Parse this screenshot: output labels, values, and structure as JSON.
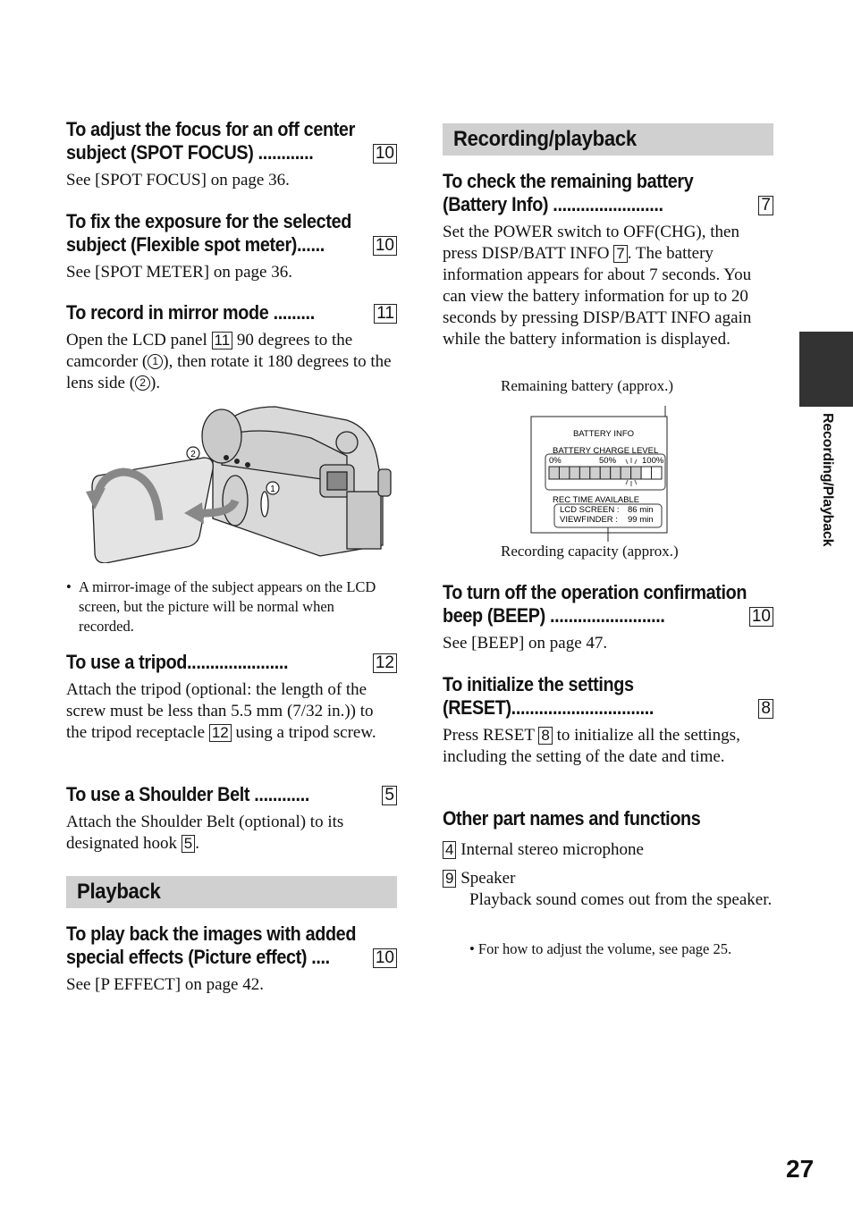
{
  "page_number": "27",
  "side_tab": {
    "label": "Recording/Playback",
    "color": "#333333"
  },
  "left": {
    "spot_focus": {
      "heading_line1": "To adjust the focus for an off center",
      "heading_line2": "subject (SPOT FOCUS) ............",
      "ref": "10",
      "body": "See [SPOT FOCUS] on page 36."
    },
    "spot_meter": {
      "heading_line1": "To fix the exposure for the selected",
      "heading_line2": "subject (Flexible spot meter)......",
      "ref": "10",
      "body": "See [SPOT METER] on page 36."
    },
    "mirror": {
      "heading": "To record in mirror mode .........",
      "ref": "11",
      "body_p1": "Open the LCD panel ",
      "body_ref": "11",
      "body_p2": " 90 degrees to the camcorder (",
      "step1": "1",
      "body_p3": "), then rotate it 180 degrees to the lens side (",
      "step2": "2",
      "body_p4": ").",
      "figure_alt": "Camcorder with LCD panel opened and rotated",
      "note": "A mirror-image of the subject appears on the LCD screen, but the picture will be normal when recorded."
    },
    "tripod": {
      "heading": "To use a tripod......................",
      "ref": "12",
      "body_p1": "Attach the tripod (optional: the length of the screw must be less than 5.5 mm (7/32 in.)) to the tripod receptacle ",
      "body_ref": "12",
      "body_p2": " using a tripod screw."
    },
    "belt": {
      "heading": "To use a Shoulder Belt ............",
      "ref": "5",
      "body_p1": "Attach the Shoulder Belt (optional) to its designated hook ",
      "body_ref": "5",
      "body_p2": "."
    },
    "playback_section": "Playback",
    "picture_effect": {
      "heading_line1": "To play back the images with added",
      "heading_line2": "special effects (Picture effect) ....",
      "ref": "10",
      "body": "See [P EFFECT] on page 42."
    }
  },
  "right": {
    "section": "Recording/playback",
    "battery": {
      "heading_line1": "To check the remaining battery",
      "heading_line2": "(Battery Info) ........................",
      "ref": "7",
      "body_p1": "Set the POWER switch to OFF(CHG), then press DISP/BATT INFO ",
      "body_ref": "7",
      "body_p2": ". The battery information appears for about 7 seconds. You can view the battery information for up to 20 seconds by pressing DISP/BATT INFO again while the battery information is displayed.",
      "callout_top": "Remaining battery (approx.)",
      "callout_bottom": "Recording capacity (approx.)",
      "screen": {
        "title": "BATTERY INFO",
        "charge_label": "BATTERY CHARGE LEVEL",
        "scale": [
          "0%",
          "50%",
          "100%"
        ],
        "segments_total": 11,
        "segments_filled": 9,
        "rec_label": "REC TIME AVAILABLE",
        "lcd_label": "LCD SCREEN :",
        "lcd_value": "86 min",
        "vf_label": "VIEWFINDER :",
        "vf_value": "99 min"
      }
    },
    "beep": {
      "heading_line1": "To turn off the operation confirmation",
      "heading_line2": "beep (BEEP) .........................",
      "ref": "10",
      "body": "See [BEEP] on page 47."
    },
    "reset": {
      "heading_line1": "To initialize the settings",
      "heading_line2": "(RESET)...............................",
      "ref": "8",
      "body_p1": "Press RESET ",
      "body_ref": "8",
      "body_p2": " to initialize all the settings, including the setting of the date and time."
    },
    "other": {
      "heading": "Other part names and functions",
      "items": [
        {
          "ref": "4",
          "text": "Internal stereo microphone"
        },
        {
          "ref": "9",
          "text": "Speaker",
          "detail": "Playback sound comes out from the speaker."
        }
      ],
      "note": "For how to adjust the volume, see page 25."
    }
  },
  "colors": {
    "band": "#d0d0d0",
    "text": "#111111"
  }
}
